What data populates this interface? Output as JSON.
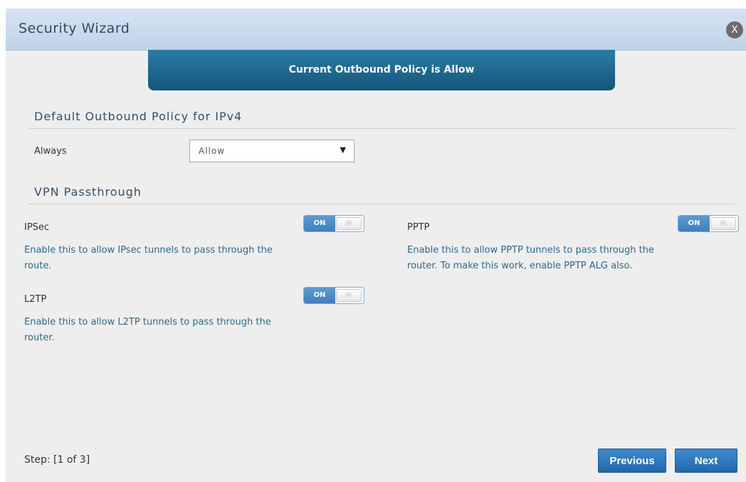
{
  "dialog": {
    "title": "Security Wizard",
    "close_label": "X"
  },
  "banner": {
    "text": "Current Outbound Policy is Allow"
  },
  "outbound_policy": {
    "heading": "Default Outbound Policy for IPv4",
    "field_label": "Always",
    "selected_value": "Allow"
  },
  "vpn": {
    "heading": "VPN Passthrough",
    "toggle_on_label": "ON",
    "toggle_knob_label": "III",
    "items": [
      {
        "name": "IPSec",
        "state": "ON",
        "description_line1": "Enable this to allow IPsec tunnels to pass through the",
        "description_line2": "route."
      },
      {
        "name": "PPTP",
        "state": "ON",
        "description_line1": "Enable this to allow PPTP tunnels to pass through the",
        "description_line2": "router. To make this work, enable PPTP ALG also."
      },
      {
        "name": "L2TP",
        "state": "ON",
        "description_line1": "Enable this to allow L2TP tunnels to pass through the",
        "description_line2": "router."
      }
    ]
  },
  "footer": {
    "step_text": "Step: [1 of 3]",
    "previous_label": "Previous",
    "next_label": "Next"
  },
  "colors": {
    "banner": "#1f6a93",
    "toggle_on": "#4a8bcb",
    "button": "#2b78bf",
    "description_text": "#2c6a8e"
  }
}
